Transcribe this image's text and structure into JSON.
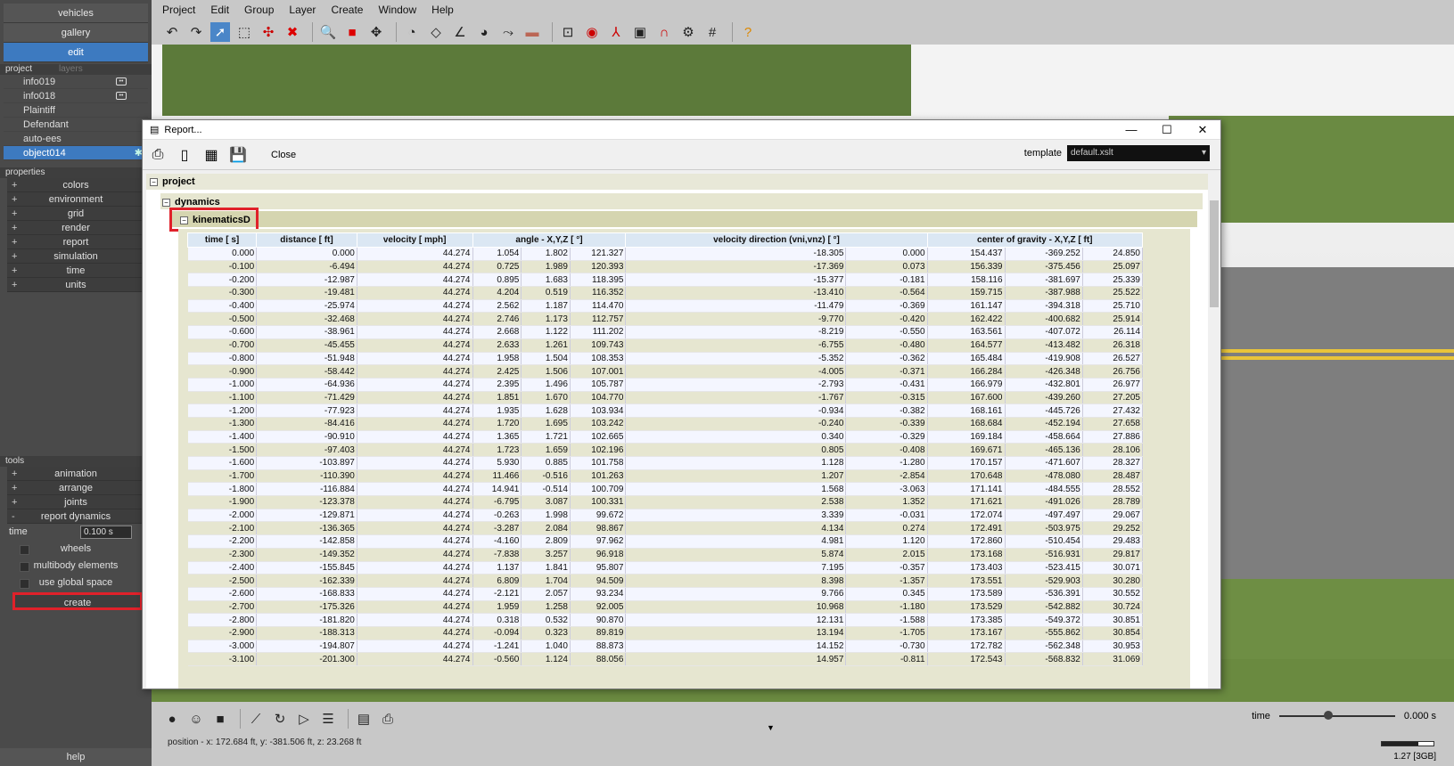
{
  "nav": [
    "vehicles",
    "gallery",
    "edit"
  ],
  "sections": {
    "project": "project",
    "layers": "layers",
    "properties": "properties",
    "tools": "tools"
  },
  "layers": [
    "info019",
    "info018",
    "Plaintiff",
    "Defendant",
    "auto-ees",
    "object014"
  ],
  "properties": [
    "colors",
    "environment",
    "grid",
    "render",
    "report",
    "simulation",
    "time",
    "units"
  ],
  "tools": [
    "animation",
    "arrange",
    "joints"
  ],
  "report_dynamics": {
    "label": "report dynamics",
    "time_label": "time",
    "time_value": "0.100 s",
    "checks": [
      "wheels",
      "multibody elements",
      "use global space"
    ],
    "create": "create"
  },
  "help": "help",
  "menu": [
    "Project",
    "Edit",
    "Group",
    "Layer",
    "Create",
    "Window",
    "Help"
  ],
  "dialog": {
    "title": "Report...",
    "close": "Close",
    "template_label": "template",
    "template_value": "default.xslt",
    "tree": [
      "project",
      "dynamics",
      "kinematicsD"
    ]
  },
  "table": {
    "headers": [
      "time [ s]",
      "distance [ ft]",
      "velocity [ mph]",
      "angle - X,Y,Z [ °]",
      "velocity direction (vni,vnz) [ °]",
      "center of gravity - X,Y,Z [ ft]"
    ],
    "rows": [
      [
        "0.000",
        "0.000",
        "44.274",
        "1.054",
        "1.802",
        "121.327",
        "-18.305",
        "0.000",
        "154.437",
        "-369.252",
        "24.850"
      ],
      [
        "-0.100",
        "-6.494",
        "44.274",
        "0.725",
        "1.989",
        "120.393",
        "-17.369",
        "0.073",
        "156.339",
        "-375.456",
        "25.097"
      ],
      [
        "-0.200",
        "-12.987",
        "44.274",
        "0.895",
        "1.683",
        "118.395",
        "-15.377",
        "-0.181",
        "158.116",
        "-381.697",
        "25.339"
      ],
      [
        "-0.300",
        "-19.481",
        "44.274",
        "4.204",
        "0.519",
        "116.352",
        "-13.410",
        "-0.564",
        "159.715",
        "-387.988",
        "25.522"
      ],
      [
        "-0.400",
        "-25.974",
        "44.274",
        "2.562",
        "1.187",
        "114.470",
        "-11.479",
        "-0.369",
        "161.147",
        "-394.318",
        "25.710"
      ],
      [
        "-0.500",
        "-32.468",
        "44.274",
        "2.746",
        "1.173",
        "112.757",
        "-9.770",
        "-0.420",
        "162.422",
        "-400.682",
        "25.914"
      ],
      [
        "-0.600",
        "-38.961",
        "44.274",
        "2.668",
        "1.122",
        "111.202",
        "-8.219",
        "-0.550",
        "163.561",
        "-407.072",
        "26.114"
      ],
      [
        "-0.700",
        "-45.455",
        "44.274",
        "2.633",
        "1.261",
        "109.743",
        "-6.755",
        "-0.480",
        "164.577",
        "-413.482",
        "26.318"
      ],
      [
        "-0.800",
        "-51.948",
        "44.274",
        "1.958",
        "1.504",
        "108.353",
        "-5.352",
        "-0.362",
        "165.484",
        "-419.908",
        "26.527"
      ],
      [
        "-0.900",
        "-58.442",
        "44.274",
        "2.425",
        "1.506",
        "107.001",
        "-4.005",
        "-0.371",
        "166.284",
        "-426.348",
        "26.756"
      ],
      [
        "-1.000",
        "-64.936",
        "44.274",
        "2.395",
        "1.496",
        "105.787",
        "-2.793",
        "-0.431",
        "166.979",
        "-432.801",
        "26.977"
      ],
      [
        "-1.100",
        "-71.429",
        "44.274",
        "1.851",
        "1.670",
        "104.770",
        "-1.767",
        "-0.315",
        "167.600",
        "-439.260",
        "27.205"
      ],
      [
        "-1.200",
        "-77.923",
        "44.274",
        "1.935",
        "1.628",
        "103.934",
        "-0.934",
        "-0.382",
        "168.161",
        "-445.726",
        "27.432"
      ],
      [
        "-1.300",
        "-84.416",
        "44.274",
        "1.720",
        "1.695",
        "103.242",
        "-0.240",
        "-0.339",
        "168.684",
        "-452.194",
        "27.658"
      ],
      [
        "-1.400",
        "-90.910",
        "44.274",
        "1.365",
        "1.721",
        "102.665",
        "0.340",
        "-0.329",
        "169.184",
        "-458.664",
        "27.886"
      ],
      [
        "-1.500",
        "-97.403",
        "44.274",
        "1.723",
        "1.659",
        "102.196",
        "0.805",
        "-0.408",
        "169.671",
        "-465.136",
        "28.106"
      ],
      [
        "-1.600",
        "-103.897",
        "44.274",
        "5.930",
        "0.885",
        "101.758",
        "1.128",
        "-1.280",
        "170.157",
        "-471.607",
        "28.327"
      ],
      [
        "-1.700",
        "-110.390",
        "44.274",
        "11.466",
        "-0.516",
        "101.263",
        "1.207",
        "-2.854",
        "170.648",
        "-478.080",
        "28.487"
      ],
      [
        "-1.800",
        "-116.884",
        "44.274",
        "14.941",
        "-0.514",
        "100.709",
        "1.568",
        "-3.063",
        "171.141",
        "-484.555",
        "28.552"
      ],
      [
        "-1.900",
        "-123.378",
        "44.274",
        "-6.795",
        "3.087",
        "100.331",
        "2.538",
        "1.352",
        "171.621",
        "-491.026",
        "28.789"
      ],
      [
        "-2.000",
        "-129.871",
        "44.274",
        "-0.263",
        "1.998",
        "99.672",
        "3.339",
        "-0.031",
        "172.074",
        "-497.497",
        "29.067"
      ],
      [
        "-2.100",
        "-136.365",
        "44.274",
        "-3.287",
        "2.084",
        "98.867",
        "4.134",
        "0.274",
        "172.491",
        "-503.975",
        "29.252"
      ],
      [
        "-2.200",
        "-142.858",
        "44.274",
        "-4.160",
        "2.809",
        "97.962",
        "4.981",
        "1.120",
        "172.860",
        "-510.454",
        "29.483"
      ],
      [
        "-2.300",
        "-149.352",
        "44.274",
        "-7.838",
        "3.257",
        "96.918",
        "5.874",
        "2.015",
        "173.168",
        "-516.931",
        "29.817"
      ],
      [
        "-2.400",
        "-155.845",
        "44.274",
        "1.137",
        "1.841",
        "95.807",
        "7.195",
        "-0.357",
        "173.403",
        "-523.415",
        "30.071"
      ],
      [
        "-2.500",
        "-162.339",
        "44.274",
        "6.809",
        "1.704",
        "94.509",
        "8.398",
        "-1.357",
        "173.551",
        "-529.903",
        "30.280"
      ],
      [
        "-2.600",
        "-168.833",
        "44.274",
        "-2.121",
        "2.057",
        "93.234",
        "9.766",
        "0.345",
        "173.589",
        "-536.391",
        "30.552"
      ],
      [
        "-2.700",
        "-175.326",
        "44.274",
        "1.959",
        "1.258",
        "92.005",
        "10.968",
        "-1.180",
        "173.529",
        "-542.882",
        "30.724"
      ],
      [
        "-2.800",
        "-181.820",
        "44.274",
        "0.318",
        "0.532",
        "90.870",
        "12.131",
        "-1.588",
        "173.385",
        "-549.372",
        "30.851"
      ],
      [
        "-2.900",
        "-188.313",
        "44.274",
        "-0.094",
        "0.323",
        "89.819",
        "13.194",
        "-1.705",
        "173.167",
        "-555.862",
        "30.854"
      ],
      [
        "-3.000",
        "-194.807",
        "44.274",
        "-1.241",
        "1.040",
        "88.873",
        "14.152",
        "-0.730",
        "172.782",
        "-562.348",
        "30.953"
      ],
      [
        "-3.100",
        "-201.300",
        "44.274",
        "-0.560",
        "1.124",
        "88.056",
        "14.957",
        "-0.811",
        "172.543",
        "-568.832",
        "31.069"
      ]
    ]
  },
  "status": {
    "position": "position - x: 172.684 ft, y: -381.506 ft, z: 23.268 ft",
    "time_label": "time",
    "time_value": "0.000 s",
    "memory": "1.27 [3GB]"
  }
}
